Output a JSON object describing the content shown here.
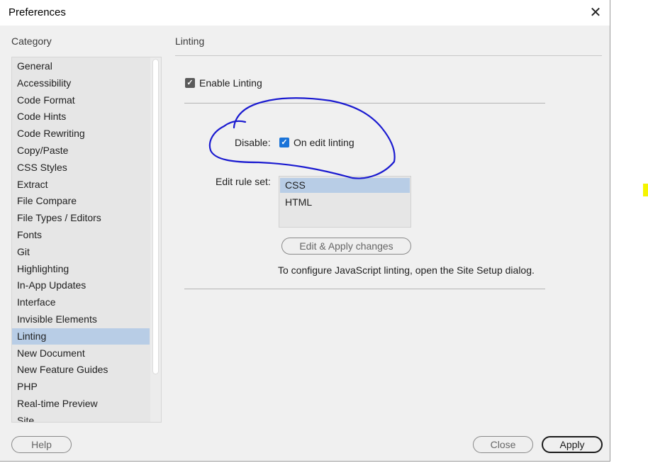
{
  "window": {
    "title": "Preferences",
    "close_glyph": "✕"
  },
  "category": {
    "label": "Category",
    "items": [
      "General",
      "Accessibility",
      "Code Format",
      "Code Hints",
      "Code Rewriting",
      "Copy/Paste",
      "CSS Styles",
      "Extract",
      "File Compare",
      "File Types / Editors",
      "Fonts",
      "Git",
      "Highlighting",
      "In-App Updates",
      "Interface",
      "Invisible Elements",
      "Linting",
      "New Document",
      "New Feature Guides",
      "PHP",
      "Real-time Preview",
      "Site"
    ],
    "selected": "Linting"
  },
  "linting": {
    "section_title": "Linting",
    "enable_label": "Enable Linting",
    "enable_checked": true,
    "disable_label": "Disable:",
    "on_edit_label": "On edit linting",
    "on_edit_checked": true,
    "rule_set_label": "Edit rule set:",
    "rule_sets": [
      "CSS",
      "HTML"
    ],
    "selected_rule_set": "CSS",
    "edit_apply_button": "Edit  & Apply changes",
    "js_note": "To configure JavaScript linting, open the Site Setup dialog."
  },
  "footer": {
    "help": "Help",
    "close": "Close",
    "apply": "Apply"
  },
  "colors": {
    "selection": "#b8cde6",
    "checkbox_blue": "#1a73d8",
    "annotation_ink": "#1a1ad0",
    "marker": "#f5f500"
  },
  "icons": {
    "checkmark": "✓"
  }
}
